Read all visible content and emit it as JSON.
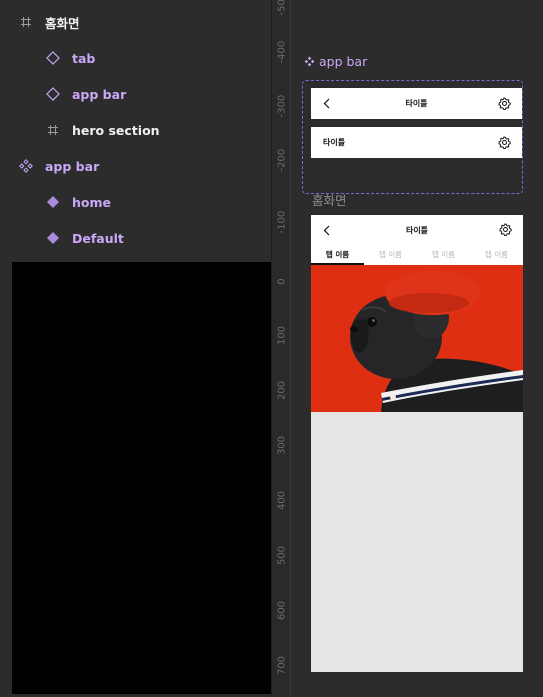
{
  "layers": {
    "items": [
      {
        "label": "홈화면",
        "icon": "frame-hash-icon",
        "tone": "white"
      },
      {
        "label": "tab",
        "icon": "component-instance-outline-icon",
        "tone": "purple"
      },
      {
        "label": "app bar",
        "icon": "component-instance-outline-icon",
        "tone": "purple"
      },
      {
        "label": "hero section",
        "icon": "frame-hash-icon",
        "tone": "white"
      },
      {
        "label": "app bar",
        "icon": "component-set-icon",
        "tone": "purple"
      },
      {
        "label": "home",
        "icon": "component-variant-icon",
        "tone": "purple"
      },
      {
        "label": "Default",
        "icon": "component-variant-icon",
        "tone": "purple"
      }
    ]
  },
  "ruler": {
    "labels": [
      "-500",
      "-400",
      "-300",
      "-200",
      "-100",
      "0",
      "100",
      "200",
      "300",
      "400",
      "500",
      "600",
      "700"
    ]
  },
  "canvas": {
    "component_set_label": "app bar",
    "variant_home_title": "타이틀",
    "variant_default_title": "타이틀",
    "frame_label": "홈화면",
    "phone": {
      "title": "타이틀",
      "tabs": [
        "탭 이름",
        "탭 이름",
        "탭 이름",
        "탭 이름"
      ],
      "active_tab": 0
    }
  },
  "colors": {
    "panel_bg": "#2c2c2c",
    "component_purple": "#c9a8f5",
    "dashed_border": "#8a63d2",
    "hero_red": "#e33214"
  }
}
